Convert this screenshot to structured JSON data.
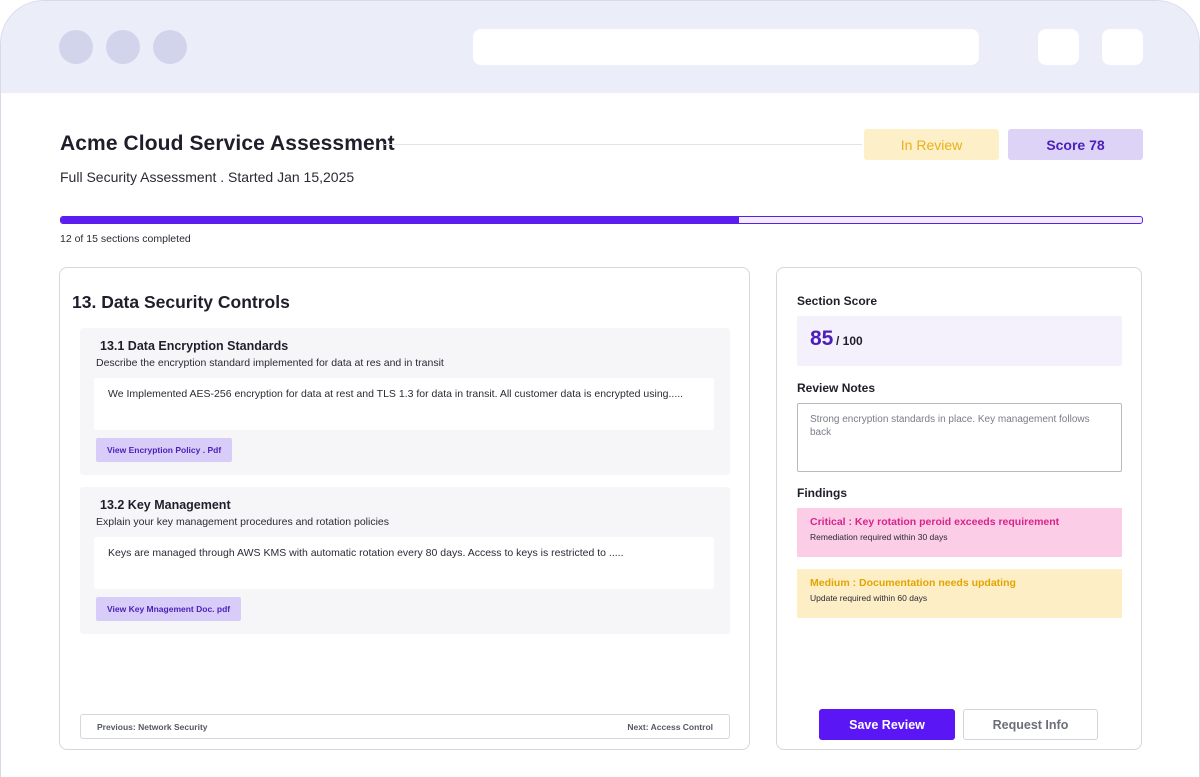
{
  "header": {
    "title": "Acme Cloud Service Assessment",
    "subtitle": "Full Security Assessment . Started Jan 15,2025",
    "status_badge": "In Review",
    "score_badge": "Score 78"
  },
  "progress": {
    "completed": 12,
    "total": 15,
    "fraction": 0.627,
    "label": "12 of 15 sections completed"
  },
  "section": {
    "title": "13. Data Security Controls",
    "questions": [
      {
        "title": "13.1 Data Encryption Standards",
        "description": "Describe the encryption standard implemented for data at res and in transit",
        "answer": "We Implemented AES-256 encryption for data at rest and TLS 1.3 for data in transit. All customer data is encrypted using.....",
        "attachment": "View Encryption Policy . Pdf"
      },
      {
        "title": "13.2 Key Management",
        "description": "Explain your key management procedures and rotation policies",
        "answer": "Keys are managed through AWS KMS with automatic rotation every 80 days. Access to keys is restricted to .....",
        "attachment": "View Key Mnagement Doc. pdf"
      }
    ],
    "nav": {
      "previous": "Previous: Network Security",
      "next": "Next: Access Control"
    }
  },
  "review": {
    "score_label": "Section Score",
    "score_value": "85",
    "score_max": "/ 100",
    "notes_label": "Review Notes",
    "notes_value": "Strong encryption standards in place. Key management follows back",
    "findings_label": "Findings",
    "findings": [
      {
        "title": "Critical : Key rotation peroid exceeds requirement",
        "detail": "Remediation required within 30 days",
        "color": "#d9238b"
      },
      {
        "title": "Medium : Documentation needs updating",
        "detail": "Update required within 60 days",
        "color": "#e2a500"
      }
    ],
    "save_label": "Save Review",
    "request_label": "Request Info"
  },
  "colors": {
    "accent": "#5a16f5",
    "chrome": "#ebedf8"
  }
}
